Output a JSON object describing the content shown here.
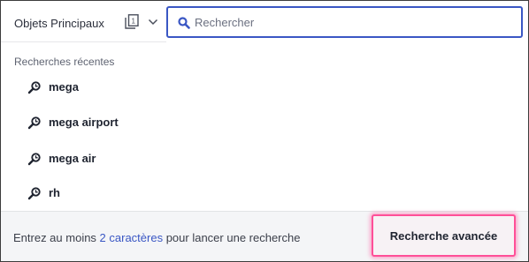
{
  "scope": {
    "label": "Objets Principaux",
    "icon": "object-type-icon",
    "dropdown_icon": "chevron-down-icon"
  },
  "search": {
    "placeholder": "Rechercher",
    "value": "",
    "icon": "search-icon",
    "accent_color": "#3a57c4"
  },
  "recent": {
    "title": "Recherches récentes",
    "icon": "history-search-icon",
    "items": [
      {
        "label": "mega"
      },
      {
        "label": "mega airport"
      },
      {
        "label": "mega air"
      },
      {
        "label": "rh"
      }
    ]
  },
  "footer": {
    "hint_prefix": "Entrez au moins ",
    "hint_link": "2 caractères",
    "hint_suffix": " pour lancer une recherche",
    "advanced_search_label": "Recherche avancée",
    "highlight_color": "#ff4f98"
  }
}
